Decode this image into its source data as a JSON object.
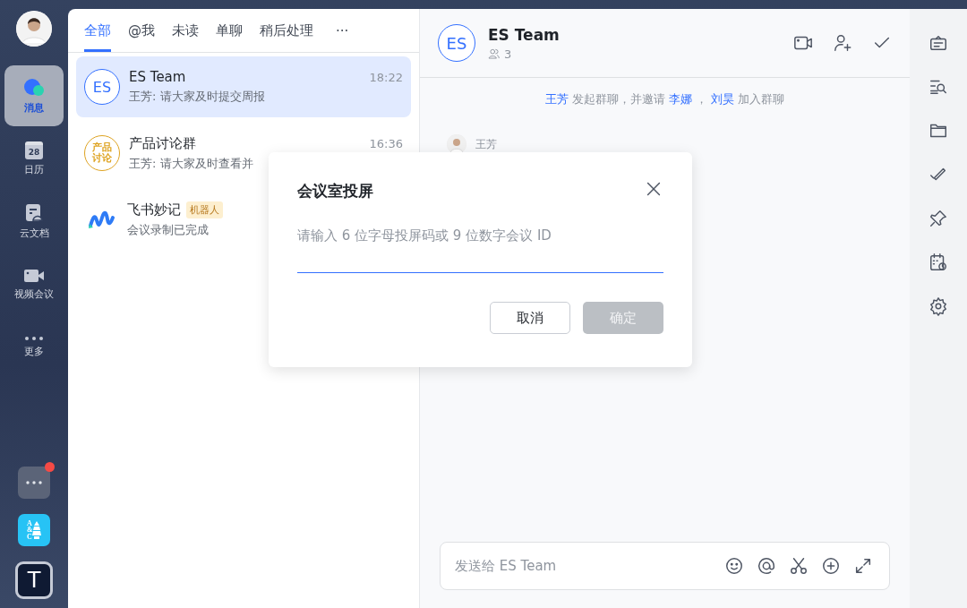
{
  "rail": {
    "items": [
      {
        "label": "消息",
        "kind": "chat",
        "selected": true
      },
      {
        "label": "日历",
        "kind": "calendar",
        "icon_text": "28",
        "selected": false
      },
      {
        "label": "云文档",
        "kind": "docs",
        "selected": false
      },
      {
        "label": "视频会议",
        "kind": "video",
        "selected": false
      },
      {
        "label": "更多",
        "kind": "more",
        "selected": false
      }
    ],
    "apps": [
      {
        "kind": "more",
        "badge": true
      },
      {
        "kind": "ac",
        "text": "A&C"
      },
      {
        "kind": "letter",
        "text": "T"
      }
    ]
  },
  "tabs": [
    {
      "label": "全部",
      "selected": true
    },
    {
      "label": "@我",
      "selected": false
    },
    {
      "label": "未读",
      "selected": false
    },
    {
      "label": "单聊",
      "selected": false
    },
    {
      "label": "稍后处理",
      "selected": false
    },
    {
      "label": "···",
      "selected": false
    }
  ],
  "chats": [
    {
      "name": "ES Team",
      "preview": "王芳: 请大家及时提交周报",
      "time": "18:22",
      "selected": true,
      "avatar": {
        "kind": "initials",
        "text": "ES",
        "color": "#3370ff"
      }
    },
    {
      "name": "产品讨论群",
      "preview": "王芳: 请大家及时查看并",
      "time": "16:36",
      "selected": false,
      "avatar": {
        "kind": "initials",
        "text": "产品讨论",
        "color": "#dea321"
      }
    },
    {
      "name": "飞书妙记",
      "tag": "机器人",
      "preview": "会议录制已完成",
      "selected": false,
      "avatar": {
        "kind": "logo"
      }
    }
  ],
  "chat": {
    "title": "ES Team",
    "avatar_text": "ES",
    "member_count": "3",
    "system_message": [
      {
        "text": "王芳",
        "kind": "mention"
      },
      {
        "text": "发起群聊，并邀请",
        "kind": "plain"
      },
      {
        "text": "李娜",
        "kind": "mention"
      },
      {
        "text": "，",
        "kind": "plain"
      },
      {
        "text": "刘昊",
        "kind": "mention"
      },
      {
        "text": "加入群聊",
        "kind": "plain"
      }
    ],
    "message": {
      "sender": "王芳"
    },
    "composer": {
      "placeholder": "发送给 ES Team"
    }
  },
  "dialog": {
    "title": "会议室投屏",
    "field": {
      "placeholder": "请输入 6 位字母投屏码或 9 位数字会议 ID"
    },
    "buttons": [
      {
        "label": "取消",
        "kind": "secondary",
        "disabled": false
      },
      {
        "label": "确定",
        "kind": "primary",
        "disabled": true
      }
    ]
  }
}
